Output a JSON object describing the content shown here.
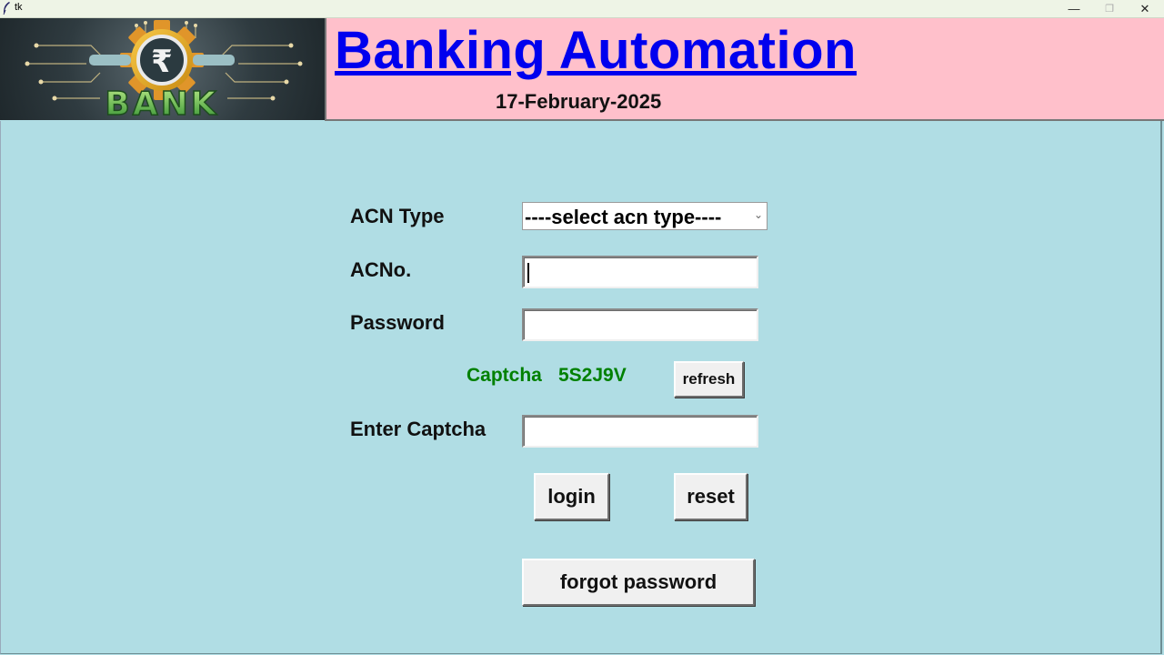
{
  "window": {
    "title": "tk",
    "minimize_glyph": "—",
    "maximize_glyph": "❐",
    "close_glyph": "✕"
  },
  "header": {
    "logo_text": "BANK",
    "logo_symbol": "₹",
    "title": "Banking Automation",
    "date": "17-February-2025"
  },
  "form": {
    "acn_type_label": "ACN Type",
    "acn_type_selected": "----select acn type----",
    "acn_no_label": "ACNo.",
    "acn_no_value": "",
    "password_label": "Password",
    "password_value": "",
    "captcha_label": "Captcha",
    "captcha_value": "5S2J9V",
    "refresh_label": "refresh",
    "enter_captcha_label": "Enter Captcha",
    "enter_captcha_value": "",
    "login_label": "login",
    "reset_label": "reset",
    "forgot_label": "forgot password"
  },
  "colors": {
    "background": "#b0dde4",
    "banner": "#ffc0cb",
    "title": "#0000ee",
    "captcha": "#008000"
  }
}
